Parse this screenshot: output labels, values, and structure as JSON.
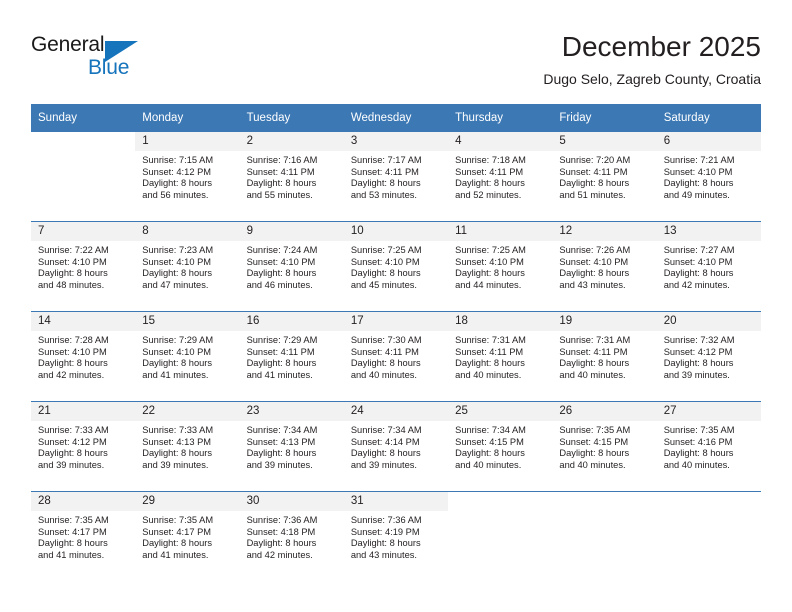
{
  "brand": {
    "name_part1": "General",
    "name_part2": "Blue",
    "accent_color": "#1574bb"
  },
  "header": {
    "title": "December 2025",
    "subtitle": "Dugo Selo, Zagreb County, Croatia"
  },
  "calendar": {
    "header_color": "#3c78b4",
    "daynum_band_color": "#f2f2f2",
    "weekdays": [
      "Sunday",
      "Monday",
      "Tuesday",
      "Wednesday",
      "Thursday",
      "Friday",
      "Saturday"
    ],
    "weeks": [
      [
        {
          "day": "",
          "sunrise": "",
          "sunset": "",
          "daylight1": "",
          "daylight2": ""
        },
        {
          "day": "1",
          "sunrise": "Sunrise: 7:15 AM",
          "sunset": "Sunset: 4:12 PM",
          "daylight1": "Daylight: 8 hours",
          "daylight2": "and 56 minutes."
        },
        {
          "day": "2",
          "sunrise": "Sunrise: 7:16 AM",
          "sunset": "Sunset: 4:11 PM",
          "daylight1": "Daylight: 8 hours",
          "daylight2": "and 55 minutes."
        },
        {
          "day": "3",
          "sunrise": "Sunrise: 7:17 AM",
          "sunset": "Sunset: 4:11 PM",
          "daylight1": "Daylight: 8 hours",
          "daylight2": "and 53 minutes."
        },
        {
          "day": "4",
          "sunrise": "Sunrise: 7:18 AM",
          "sunset": "Sunset: 4:11 PM",
          "daylight1": "Daylight: 8 hours",
          "daylight2": "and 52 minutes."
        },
        {
          "day": "5",
          "sunrise": "Sunrise: 7:20 AM",
          "sunset": "Sunset: 4:11 PM",
          "daylight1": "Daylight: 8 hours",
          "daylight2": "and 51 minutes."
        },
        {
          "day": "6",
          "sunrise": "Sunrise: 7:21 AM",
          "sunset": "Sunset: 4:10 PM",
          "daylight1": "Daylight: 8 hours",
          "daylight2": "and 49 minutes."
        }
      ],
      [
        {
          "day": "7",
          "sunrise": "Sunrise: 7:22 AM",
          "sunset": "Sunset: 4:10 PM",
          "daylight1": "Daylight: 8 hours",
          "daylight2": "and 48 minutes."
        },
        {
          "day": "8",
          "sunrise": "Sunrise: 7:23 AM",
          "sunset": "Sunset: 4:10 PM",
          "daylight1": "Daylight: 8 hours",
          "daylight2": "and 47 minutes."
        },
        {
          "day": "9",
          "sunrise": "Sunrise: 7:24 AM",
          "sunset": "Sunset: 4:10 PM",
          "daylight1": "Daylight: 8 hours",
          "daylight2": "and 46 minutes."
        },
        {
          "day": "10",
          "sunrise": "Sunrise: 7:25 AM",
          "sunset": "Sunset: 4:10 PM",
          "daylight1": "Daylight: 8 hours",
          "daylight2": "and 45 minutes."
        },
        {
          "day": "11",
          "sunrise": "Sunrise: 7:25 AM",
          "sunset": "Sunset: 4:10 PM",
          "daylight1": "Daylight: 8 hours",
          "daylight2": "and 44 minutes."
        },
        {
          "day": "12",
          "sunrise": "Sunrise: 7:26 AM",
          "sunset": "Sunset: 4:10 PM",
          "daylight1": "Daylight: 8 hours",
          "daylight2": "and 43 minutes."
        },
        {
          "day": "13",
          "sunrise": "Sunrise: 7:27 AM",
          "sunset": "Sunset: 4:10 PM",
          "daylight1": "Daylight: 8 hours",
          "daylight2": "and 42 minutes."
        }
      ],
      [
        {
          "day": "14",
          "sunrise": "Sunrise: 7:28 AM",
          "sunset": "Sunset: 4:10 PM",
          "daylight1": "Daylight: 8 hours",
          "daylight2": "and 42 minutes."
        },
        {
          "day": "15",
          "sunrise": "Sunrise: 7:29 AM",
          "sunset": "Sunset: 4:10 PM",
          "daylight1": "Daylight: 8 hours",
          "daylight2": "and 41 minutes."
        },
        {
          "day": "16",
          "sunrise": "Sunrise: 7:29 AM",
          "sunset": "Sunset: 4:11 PM",
          "daylight1": "Daylight: 8 hours",
          "daylight2": "and 41 minutes."
        },
        {
          "day": "17",
          "sunrise": "Sunrise: 7:30 AM",
          "sunset": "Sunset: 4:11 PM",
          "daylight1": "Daylight: 8 hours",
          "daylight2": "and 40 minutes."
        },
        {
          "day": "18",
          "sunrise": "Sunrise: 7:31 AM",
          "sunset": "Sunset: 4:11 PM",
          "daylight1": "Daylight: 8 hours",
          "daylight2": "and 40 minutes."
        },
        {
          "day": "19",
          "sunrise": "Sunrise: 7:31 AM",
          "sunset": "Sunset: 4:11 PM",
          "daylight1": "Daylight: 8 hours",
          "daylight2": "and 40 minutes."
        },
        {
          "day": "20",
          "sunrise": "Sunrise: 7:32 AM",
          "sunset": "Sunset: 4:12 PM",
          "daylight1": "Daylight: 8 hours",
          "daylight2": "and 39 minutes."
        }
      ],
      [
        {
          "day": "21",
          "sunrise": "Sunrise: 7:33 AM",
          "sunset": "Sunset: 4:12 PM",
          "daylight1": "Daylight: 8 hours",
          "daylight2": "and 39 minutes."
        },
        {
          "day": "22",
          "sunrise": "Sunrise: 7:33 AM",
          "sunset": "Sunset: 4:13 PM",
          "daylight1": "Daylight: 8 hours",
          "daylight2": "and 39 minutes."
        },
        {
          "day": "23",
          "sunrise": "Sunrise: 7:34 AM",
          "sunset": "Sunset: 4:13 PM",
          "daylight1": "Daylight: 8 hours",
          "daylight2": "and 39 minutes."
        },
        {
          "day": "24",
          "sunrise": "Sunrise: 7:34 AM",
          "sunset": "Sunset: 4:14 PM",
          "daylight1": "Daylight: 8 hours",
          "daylight2": "and 39 minutes."
        },
        {
          "day": "25",
          "sunrise": "Sunrise: 7:34 AM",
          "sunset": "Sunset: 4:15 PM",
          "daylight1": "Daylight: 8 hours",
          "daylight2": "and 40 minutes."
        },
        {
          "day": "26",
          "sunrise": "Sunrise: 7:35 AM",
          "sunset": "Sunset: 4:15 PM",
          "daylight1": "Daylight: 8 hours",
          "daylight2": "and 40 minutes."
        },
        {
          "day": "27",
          "sunrise": "Sunrise: 7:35 AM",
          "sunset": "Sunset: 4:16 PM",
          "daylight1": "Daylight: 8 hours",
          "daylight2": "and 40 minutes."
        }
      ],
      [
        {
          "day": "28",
          "sunrise": "Sunrise: 7:35 AM",
          "sunset": "Sunset: 4:17 PM",
          "daylight1": "Daylight: 8 hours",
          "daylight2": "and 41 minutes."
        },
        {
          "day": "29",
          "sunrise": "Sunrise: 7:35 AM",
          "sunset": "Sunset: 4:17 PM",
          "daylight1": "Daylight: 8 hours",
          "daylight2": "and 41 minutes."
        },
        {
          "day": "30",
          "sunrise": "Sunrise: 7:36 AM",
          "sunset": "Sunset: 4:18 PM",
          "daylight1": "Daylight: 8 hours",
          "daylight2": "and 42 minutes."
        },
        {
          "day": "31",
          "sunrise": "Sunrise: 7:36 AM",
          "sunset": "Sunset: 4:19 PM",
          "daylight1": "Daylight: 8 hours",
          "daylight2": "and 43 minutes."
        },
        {
          "day": "",
          "sunrise": "",
          "sunset": "",
          "daylight1": "",
          "daylight2": ""
        },
        {
          "day": "",
          "sunrise": "",
          "sunset": "",
          "daylight1": "",
          "daylight2": ""
        },
        {
          "day": "",
          "sunrise": "",
          "sunset": "",
          "daylight1": "",
          "daylight2": ""
        }
      ]
    ]
  }
}
